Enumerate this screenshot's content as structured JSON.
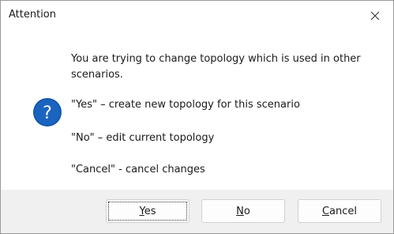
{
  "window": {
    "title": "Attention"
  },
  "icons": {
    "close": "close-icon",
    "info": "question-icon",
    "accent": "#1a64c0"
  },
  "message": {
    "main_line1": "You are trying to change topology which is used in other",
    "main_line2": "scenarios.",
    "yes_text": "\"Yes\" – create new topology for this scenario",
    "no_text": "\"No\" – edit current topology",
    "cancel_text": "\"Cancel\" - cancel changes"
  },
  "buttons": {
    "yes": {
      "mnemonic": "Y",
      "rest": "es"
    },
    "no": {
      "mnemonic": "N",
      "rest": "o"
    },
    "cancel": {
      "mnemonic": "C",
      "rest": "ancel"
    }
  }
}
